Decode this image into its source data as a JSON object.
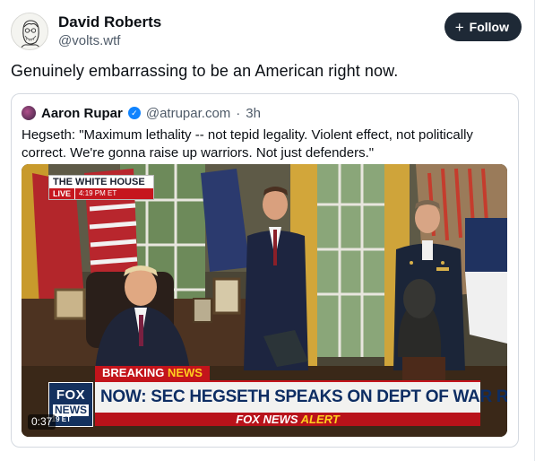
{
  "post": {
    "author": {
      "display_name": "David Roberts",
      "handle": "@volts.wtf",
      "avatar_icon": "sketch-portrait-avatar"
    },
    "follow_button": {
      "icon": "plus-icon",
      "label": "Follow"
    },
    "text": "Genuinely embarrassing to be an American right now."
  },
  "quote": {
    "author": {
      "display_name": "Aaron Rupar",
      "verified_icon": "verified-check-icon",
      "handle": "@atrupar.com",
      "separator": "·",
      "time": "3h"
    },
    "text": "Hegseth: \"Maximum lethality -- not tepid legality. Violent effect, not politically correct. We're gonna raise up warriors. Not just defenders.\"",
    "video": {
      "bug": {
        "title": "THE WHITE HOUSE",
        "live": "LIVE",
        "time": "4:19 PM ET"
      },
      "breaking_label_1": "BREAKING ",
      "breaking_label_2": "NEWS",
      "logo_line_1": "FOX",
      "logo_line_2": "NEWS",
      "logo_time": ":19 ET",
      "headline": "NOW: SEC HEGSETH SPEAKS ON DEPT OF WAR REVIVAL",
      "alert_1": "FOX NEWS ",
      "alert_2": "ALERT",
      "duration": "0:37"
    }
  },
  "colors": {
    "follow_bg": "#1e2936",
    "verified": "#1083fe",
    "fox_red": "#c3141b",
    "fox_navy": "#14315e",
    "fox_yellow": "#ffce1f"
  }
}
